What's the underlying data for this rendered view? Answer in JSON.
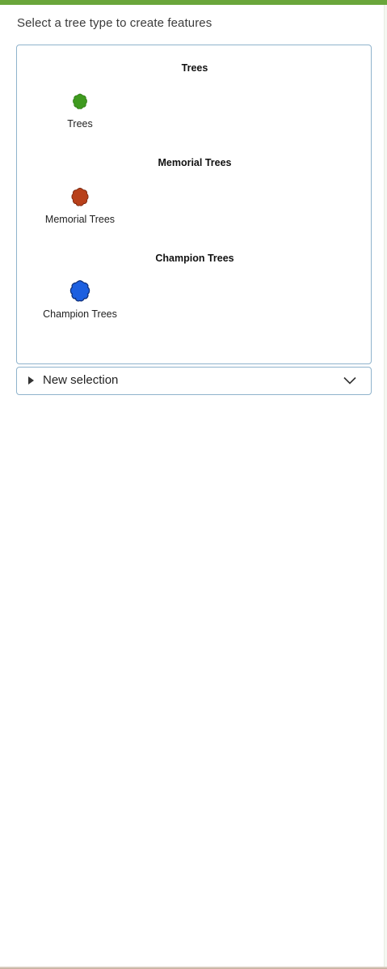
{
  "header": {
    "instruction": "Select a tree type to create features"
  },
  "templates": {
    "groups": [
      {
        "title": "Trees",
        "item_label": "Trees",
        "symbol": "tree-symbol",
        "color": "#3f9a1f"
      },
      {
        "title": "Memorial Trees",
        "item_label": "Memorial Trees",
        "symbol": "tree-symbol",
        "color": "#b8401a"
      },
      {
        "title": "Champion Trees",
        "item_label": "Champion Trees",
        "symbol": "tree-symbol",
        "color": "#1c5fe0"
      }
    ]
  },
  "selection": {
    "label": "New selection",
    "expand_icon": "triangle-right-icon",
    "dropdown_icon": "chevron-down-icon"
  },
  "colors": {
    "accent": "#6aa63b",
    "border": "#8fb3cc"
  }
}
